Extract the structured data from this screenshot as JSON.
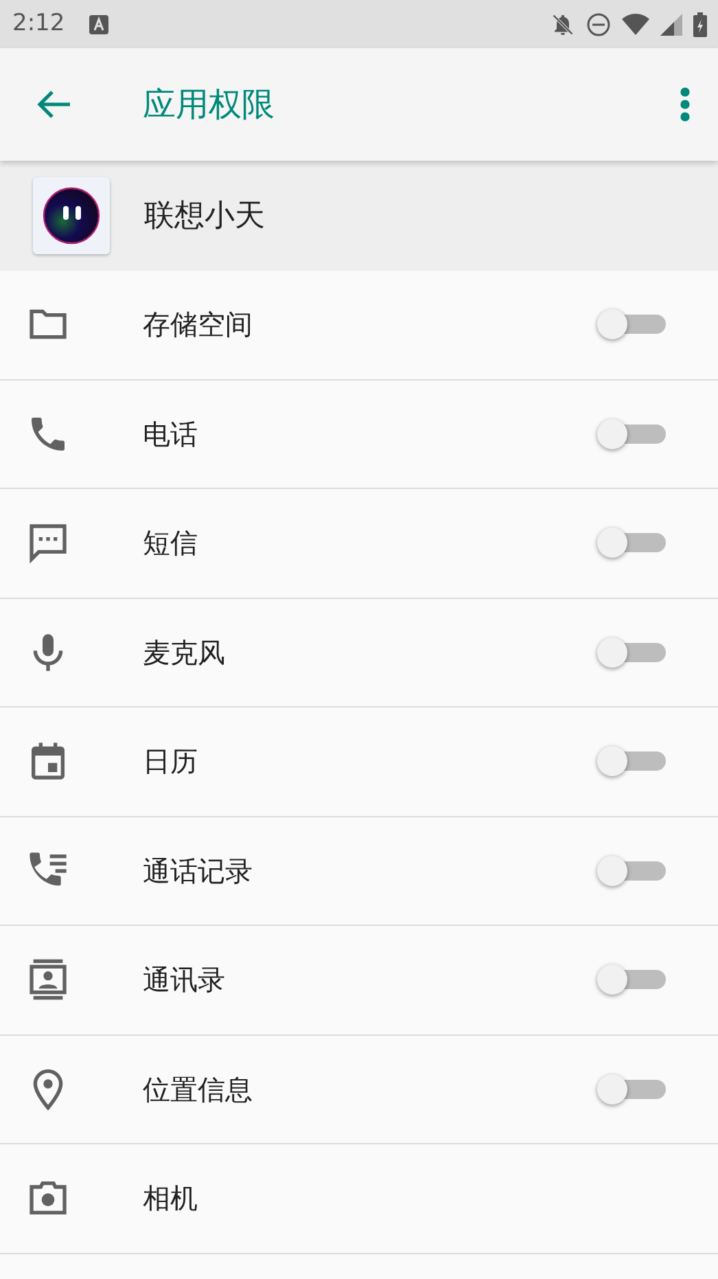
{
  "status_bar": {
    "time": "2:12"
  },
  "toolbar": {
    "title": "应用权限"
  },
  "app": {
    "name": "联想小天"
  },
  "permissions": [
    {
      "kind": "storage",
      "label": "存储空间",
      "on": false
    },
    {
      "kind": "phone",
      "label": "电话",
      "on": false
    },
    {
      "kind": "sms",
      "label": "短信",
      "on": false
    },
    {
      "kind": "microphone",
      "label": "麦克风",
      "on": false
    },
    {
      "kind": "calendar",
      "label": "日历",
      "on": false
    },
    {
      "kind": "call-log",
      "label": "通话记录",
      "on": false
    },
    {
      "kind": "contacts",
      "label": "通讯录",
      "on": false
    },
    {
      "kind": "location",
      "label": "位置信息",
      "on": false
    },
    {
      "kind": "camera",
      "label": "相机"
    }
  ]
}
